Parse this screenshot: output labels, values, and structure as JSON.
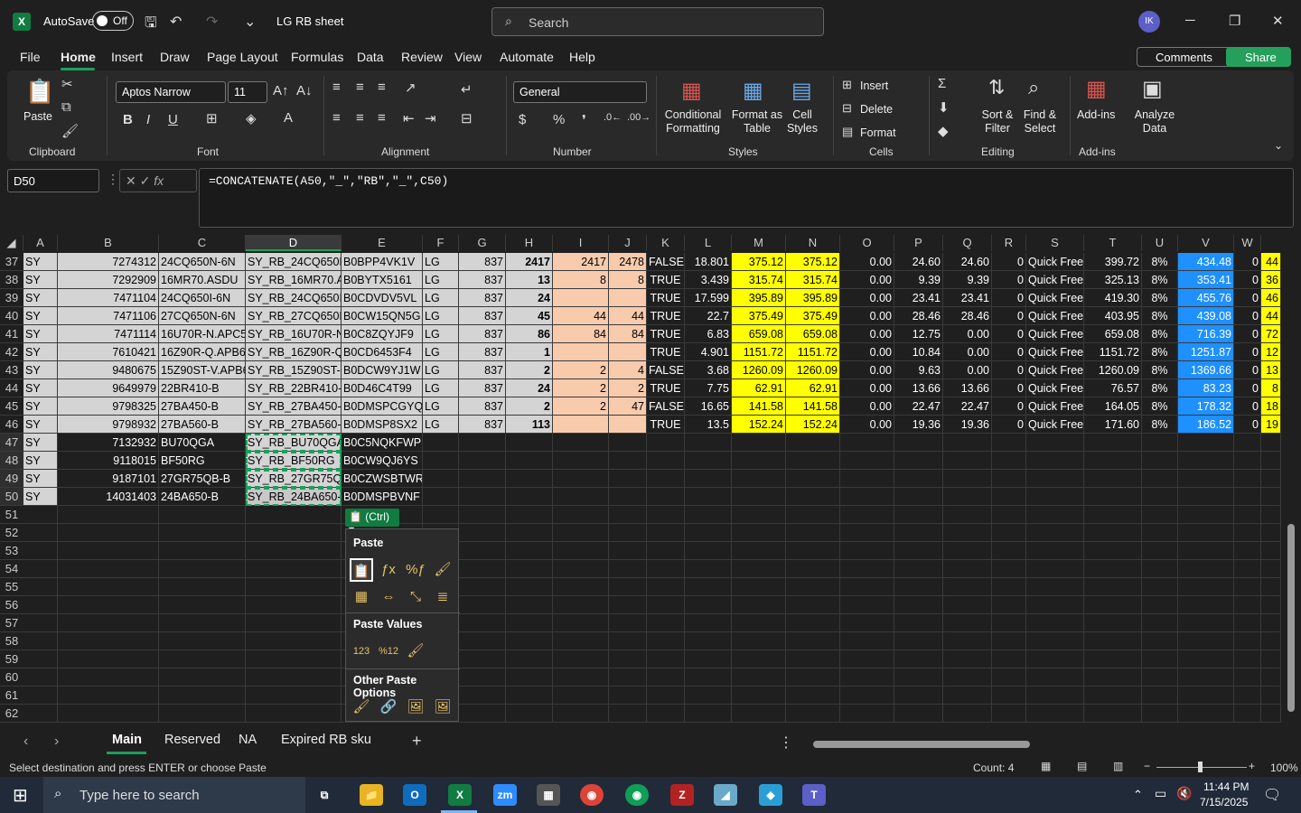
{
  "title": {
    "autosave": "AutoSave",
    "toggle": "Off",
    "doc": "LG RB sheet",
    "search_placeholder": "Search",
    "avatar": "IK"
  },
  "menu": [
    "File",
    "Home",
    "Insert",
    "Draw",
    "Page Layout",
    "Formulas",
    "Data",
    "Review",
    "View",
    "Automate",
    "Help"
  ],
  "comments": "Comments",
  "share": "Share",
  "ribbon": {
    "paste": "Paste",
    "clipboard": "Clipboard",
    "font_name": "Aptos Narrow",
    "font_size": "11",
    "font": "Font",
    "alignment": "Alignment",
    "number_format": "General",
    "number": "Number",
    "cond": "Conditional Formatting",
    "fmt_table": "Format as Table",
    "cell_styles": "Cell Styles",
    "styles": "Styles",
    "insert": "Insert",
    "delete": "Delete",
    "format": "Format",
    "cells": "Cells",
    "sort": "Sort & Filter",
    "find": "Find & Select",
    "editing": "Editing",
    "addins": "Add-ins",
    "analyze": "Analyze Data",
    "addins_group": "Add-ins"
  },
  "namebox": "D50",
  "formula": "=CONCATENATE(A50,\"_\",\"RB\",\"_\",C50)",
  "columns": [
    "A",
    "B",
    "C",
    "D",
    "E",
    "F",
    "G",
    "H",
    "I",
    "J",
    "K",
    "L",
    "M",
    "N",
    "O",
    "P",
    "Q",
    "R",
    "S",
    "T",
    "U",
    "V",
    "W"
  ],
  "rows": [
    {
      "n": "37",
      "A": "SY",
      "B": "7274312",
      "C": "24CQ650N-6N",
      "D": "SY_RB_24CQ650N",
      "E": "B0BPP4VK1V",
      "F": "LG",
      "G": "837",
      "H": "2417",
      "I": "2417",
      "J": "2478",
      "K": "FALSE",
      "L": "18.801",
      "M": "375.12",
      "N": "375.12",
      "O": "0.00",
      "P": "24.60",
      "Q": "24.60",
      "R": "0",
      "S": "Quick Free",
      "T": "399.72",
      "U": "8%",
      "V": "434.48",
      "W": "0",
      "X": "44"
    },
    {
      "n": "38",
      "A": "SY",
      "B": "7292909",
      "C": "16MR70.ASDU",
      "D": "SY_RB_16MR70.AS",
      "E": "B0BYTX5161",
      "F": "LG",
      "G": "837",
      "H": "13",
      "I": "8",
      "J": "8",
      "K": "TRUE",
      "L": "3.439",
      "M": "315.74",
      "N": "315.74",
      "O": "0.00",
      "P": "9.39",
      "Q": "9.39",
      "R": "0",
      "S": "Quick Free",
      "T": "325.13",
      "U": "8%",
      "V": "353.41",
      "W": "0",
      "X": "36"
    },
    {
      "n": "39",
      "A": "SY",
      "B": "7471104",
      "C": "24CQ650I-6N",
      "D": "SY_RB_24CQ650I-",
      "E": "B0CDVDV5VL",
      "F": "LG",
      "G": "837",
      "H": "24",
      "I": "",
      "J": "",
      "K": "TRUE",
      "L": "17.599",
      "M": "395.89",
      "N": "395.89",
      "O": "0.00",
      "P": "23.41",
      "Q": "23.41",
      "R": "0",
      "S": "Quick Free",
      "T": "419.30",
      "U": "8%",
      "V": "455.76",
      "W": "0",
      "X": "46"
    },
    {
      "n": "40",
      "A": "SY",
      "B": "7471106",
      "C": "27CQ650N-6N",
      "D": "SY_RB_27CQ650N",
      "E": "B0CW15QN5G",
      "F": "LG",
      "G": "837",
      "H": "45",
      "I": "44",
      "J": "44",
      "K": "TRUE",
      "L": "22.7",
      "M": "375.49",
      "N": "375.49",
      "O": "0.00",
      "P": "28.46",
      "Q": "28.46",
      "R": "0",
      "S": "Quick Free",
      "T": "403.95",
      "U": "8%",
      "V": "439.08",
      "W": "0",
      "X": "44"
    },
    {
      "n": "41",
      "A": "SY",
      "B": "7471114",
      "C": "16U70R-N.APC5",
      "D": "SY_RB_16U70R-N",
      "E": "B0C8ZQYJF9",
      "F": "LG",
      "G": "837",
      "H": "86",
      "I": "84",
      "J": "84",
      "K": "TRUE",
      "L": "6.83",
      "M": "659.08",
      "N": "659.08",
      "O": "0.00",
      "P": "12.75",
      "Q": "0.00",
      "R": "0",
      "S": "Quick Free",
      "T": "659.08",
      "U": "8%",
      "V": "716.39",
      "W": "0",
      "X": "72"
    },
    {
      "n": "42",
      "A": "SY",
      "B": "7610421",
      "C": "16Z90R-Q.APB6",
      "D": "SY_RB_16Z90R-Q.",
      "E": "B0CD6453F4",
      "F": "LG",
      "G": "837",
      "H": "1",
      "I": "",
      "J": "",
      "K": "TRUE",
      "L": "4.901",
      "M": "1151.72",
      "N": "1151.72",
      "O": "0.00",
      "P": "10.84",
      "Q": "0.00",
      "R": "0",
      "S": "Quick Free",
      "T": "1151.72",
      "U": "8%",
      "V": "1251.87",
      "W": "0",
      "X": "12"
    },
    {
      "n": "43",
      "A": "SY",
      "B": "9480675",
      "C": "15Z90ST-V.APB6",
      "D": "SY_RB_15Z90ST-V",
      "E": "B0DCW9YJ1W",
      "F": "LG",
      "G": "837",
      "H": "2",
      "I": "2",
      "J": "4",
      "K": "FALSE",
      "L": "3.68",
      "M": "1260.09",
      "N": "1260.09",
      "O": "0.00",
      "P": "9.63",
      "Q": "0.00",
      "R": "0",
      "S": "Quick Free",
      "T": "1260.09",
      "U": "8%",
      "V": "1369.66",
      "W": "0",
      "X": "13"
    },
    {
      "n": "44",
      "A": "SY",
      "B": "9649979",
      "C": "22BR410-B",
      "D": "SY_RB_22BR410-B",
      "E": "B0D46C4T99",
      "F": "LG",
      "G": "837",
      "H": "24",
      "I": "2",
      "J": "2",
      "K": "TRUE",
      "L": "7.75",
      "M": "62.91",
      "N": "62.91",
      "O": "0.00",
      "P": "13.66",
      "Q": "13.66",
      "R": "0",
      "S": "Quick Free",
      "T": "76.57",
      "U": "8%",
      "V": "83.23",
      "W": "0",
      "X": "8"
    },
    {
      "n": "45",
      "A": "SY",
      "B": "9798325",
      "C": "27BA450-B",
      "D": "SY_RB_27BA450-B",
      "E": "B0DMSPCGYQ",
      "F": "LG",
      "G": "837",
      "H": "2",
      "I": "2",
      "J": "47",
      "K": "FALSE",
      "L": "16.65",
      "M": "141.58",
      "N": "141.58",
      "O": "0.00",
      "P": "22.47",
      "Q": "22.47",
      "R": "0",
      "S": "Quick Free",
      "T": "164.05",
      "U": "8%",
      "V": "178.32",
      "W": "0",
      "X": "18"
    },
    {
      "n": "46",
      "A": "SY",
      "B": "9798932",
      "C": "27BA560-B",
      "D": "SY_RB_27BA560-B",
      "E": "B0DMSP8SX2",
      "F": "LG",
      "G": "837",
      "H": "113",
      "I": "",
      "J": "",
      "K": "TRUE",
      "L": "13.5",
      "M": "152.24",
      "N": "152.24",
      "O": "0.00",
      "P": "19.36",
      "Q": "19.36",
      "R": "0",
      "S": "Quick Free",
      "T": "171.60",
      "U": "8%",
      "V": "186.52",
      "W": "0",
      "X": "19"
    }
  ],
  "rows2": [
    {
      "n": "47",
      "A": "SY",
      "B": "7132932",
      "C": "BU70QGA",
      "D": "SY_RB_BU70QGA",
      "E": "B0C5NQKFWP"
    },
    {
      "n": "48",
      "A": "SY",
      "B": "9118015",
      "C": "BF50RG",
      "D": "SY_RB_BF50RG",
      "E": "B0CW9QJ6YS"
    },
    {
      "n": "49",
      "A": "SY",
      "B": "9187101",
      "C": "27GR75QB-B",
      "D": "SY_RB_27GR75QB",
      "E": "B0CZWSBTWR"
    },
    {
      "n": "50",
      "A": "SY",
      "B": "14031403",
      "C": "24BA650-B",
      "D": "SY_RB_24BA650-B",
      "E": "B0DMSPBVNF"
    }
  ],
  "empty_rows": [
    "51",
    "52",
    "53",
    "54",
    "55",
    "56",
    "57",
    "58",
    "59",
    "60",
    "61",
    "62"
  ],
  "paste_menu": {
    "ctrl": "(Ctrl)",
    "paste": "Paste",
    "paste_values": "Paste Values",
    "other": "Other Paste Options"
  },
  "tabs": [
    "Main",
    "Reserved",
    "NA",
    "Expired RB sku"
  ],
  "status": {
    "msg": "Select destination and press ENTER or choose Paste",
    "count": "Count: 4",
    "zoom": "100%"
  },
  "taskbar": {
    "search": "Type here to search",
    "time": "11:44 PM",
    "date": "7/15/2025"
  }
}
